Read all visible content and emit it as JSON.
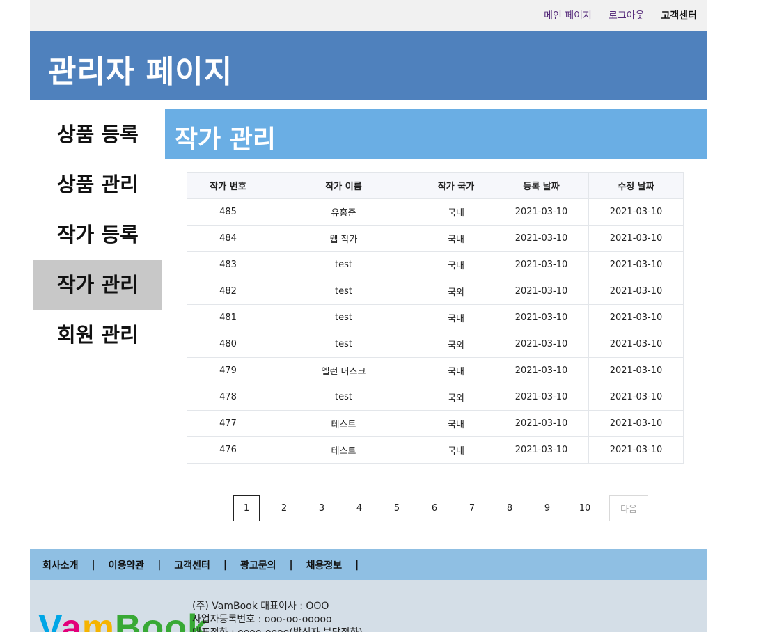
{
  "topbar": {
    "links": [
      "메인 페이지",
      "로그아웃",
      "고객센터"
    ]
  },
  "header": {
    "title": "관리자 페이지"
  },
  "sidebar": {
    "items": [
      {
        "label": "상품 등록",
        "active": false
      },
      {
        "label": "상품 관리",
        "active": false
      },
      {
        "label": "작가 등록",
        "active": false
      },
      {
        "label": "작가 관리",
        "active": true
      },
      {
        "label": "회원 관리",
        "active": false
      }
    ]
  },
  "main": {
    "title": "작가 관리",
    "table": {
      "columns": [
        "작가 번호",
        "작가 이름",
        "작가 국가",
        "등록 날짜",
        "수정 날짜"
      ],
      "rows": [
        [
          "485",
          "유홍준",
          "국내",
          "2021-03-10",
          "2021-03-10"
        ],
        [
          "484",
          "웹 작가",
          "국내",
          "2021-03-10",
          "2021-03-10"
        ],
        [
          "483",
          "test",
          "국내",
          "2021-03-10",
          "2021-03-10"
        ],
        [
          "482",
          "test",
          "국외",
          "2021-03-10",
          "2021-03-10"
        ],
        [
          "481",
          "test",
          "국내",
          "2021-03-10",
          "2021-03-10"
        ],
        [
          "480",
          "test",
          "국외",
          "2021-03-10",
          "2021-03-10"
        ],
        [
          "479",
          "엘런 머스크",
          "국내",
          "2021-03-10",
          "2021-03-10"
        ],
        [
          "478",
          "test",
          "국외",
          "2021-03-10",
          "2021-03-10"
        ],
        [
          "477",
          "테스트",
          "국내",
          "2021-03-10",
          "2021-03-10"
        ],
        [
          "476",
          "테스트",
          "국내",
          "2021-03-10",
          "2021-03-10"
        ]
      ]
    },
    "pagination": {
      "pages": [
        "1",
        "2",
        "3",
        "4",
        "5",
        "6",
        "7",
        "8",
        "9",
        "10"
      ],
      "current": "1",
      "next_label": "다음"
    }
  },
  "footer": {
    "nav": [
      "회사소개",
      "이용약관",
      "고객센터",
      "광고문의",
      "채용정보"
    ],
    "separator": "|",
    "logo_text": "VamBook",
    "info": [
      "(주) VamBook 대표이사 : OOO",
      "사업자등록번호 : ooo-oo-ooooo",
      "대표전화 : oooo-oooo(발신자 부담전화)"
    ]
  },
  "colors": {
    "banner": "#4f81bd",
    "content_title": "#6aaee4",
    "sidebar_active": "#c8c8c8",
    "footer_nav": "#8fbfe3",
    "footer_info": "#d4dee7",
    "link": "#552a7a"
  }
}
